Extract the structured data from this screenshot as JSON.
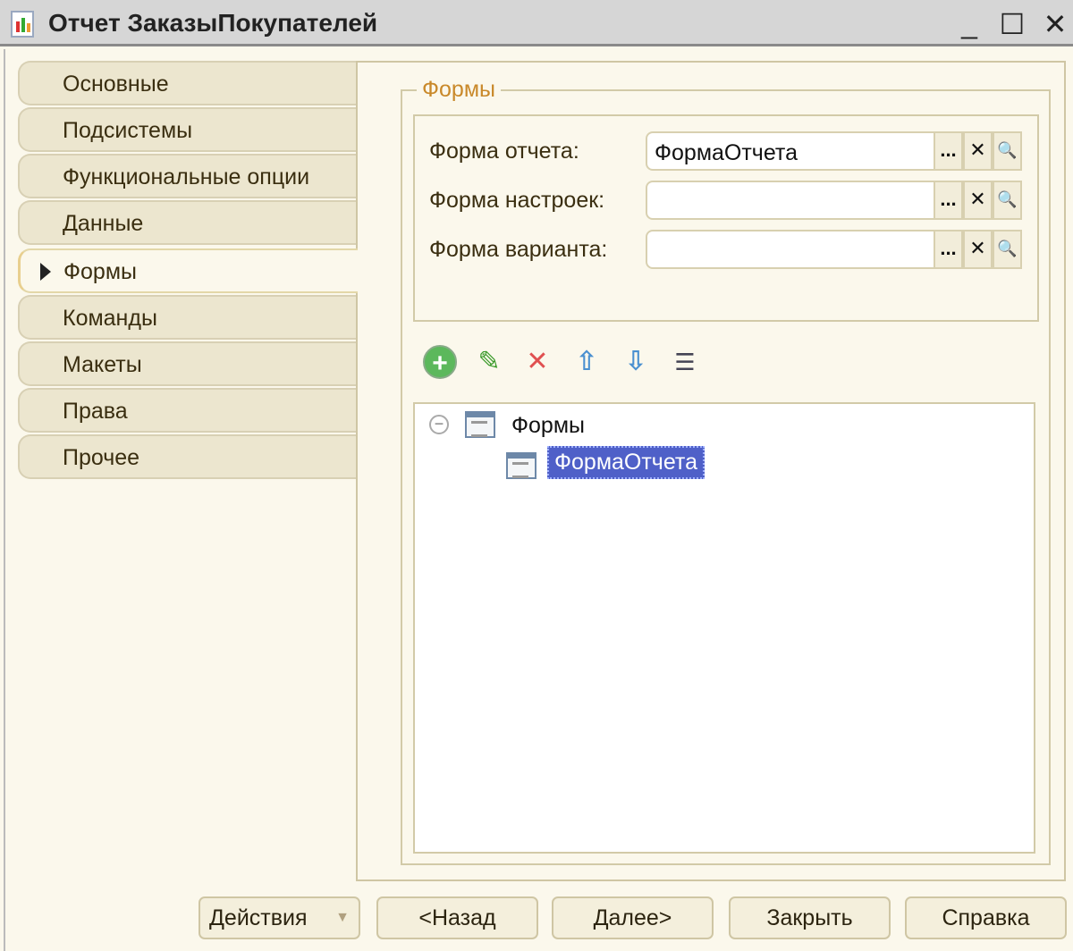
{
  "window": {
    "title": "Отчет ЗаказыПокупателей",
    "minimize": "_",
    "maximize": "☐",
    "close": "✕"
  },
  "tabs": [
    {
      "label": "Основные"
    },
    {
      "label": "Подсистемы"
    },
    {
      "label": "Функциональные опции"
    },
    {
      "label": "Данные"
    },
    {
      "label": "Формы",
      "active": true
    },
    {
      "label": "Команды"
    },
    {
      "label": "Макеты"
    },
    {
      "label": "Права"
    },
    {
      "label": "Прочее"
    }
  ],
  "group": {
    "title": "Формы"
  },
  "fields": [
    {
      "label": "Форма отчета:",
      "value": "ФормаОтчета"
    },
    {
      "label": "Форма настроек:",
      "value": ""
    },
    {
      "label": "Форма варианта:",
      "value": ""
    }
  ],
  "field_buttons": {
    "select": "...",
    "clear": "✕",
    "open": "🔍"
  },
  "tree": {
    "root": "Формы",
    "child": "ФормаОтчета"
  },
  "footer": {
    "actions": "Действия",
    "back": "<Назад",
    "next": "Далее>",
    "close": "Закрыть",
    "help": "Справка"
  }
}
